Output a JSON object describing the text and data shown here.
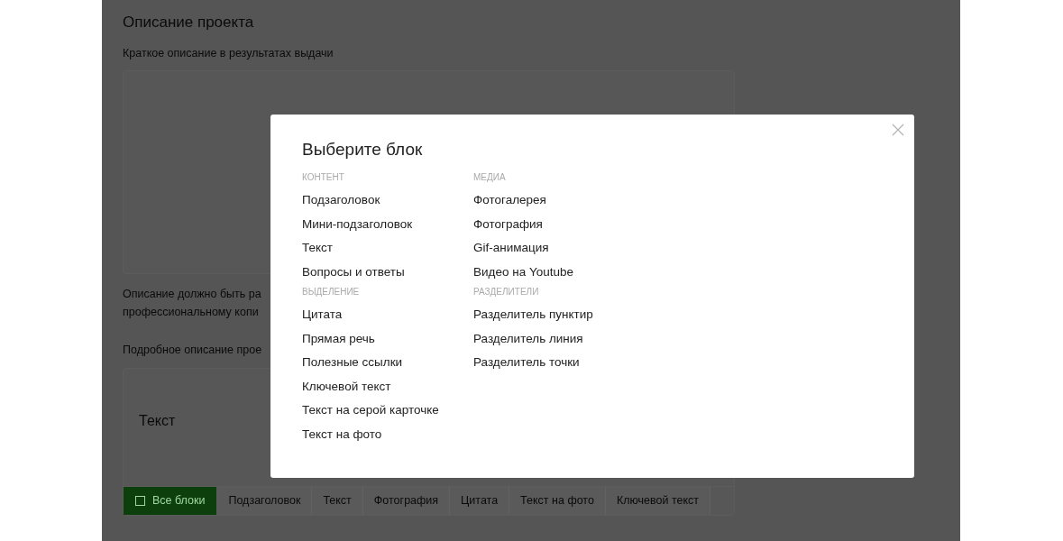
{
  "page": {
    "title": "Описание проекта",
    "short_label": "Краткое описание в результатах выдачи",
    "hint_lines": [
      "Описание должно быть ра",
      "профессиональному копи"
    ],
    "full_label": "Подробное описание прое",
    "editor_placeholder": "Текст",
    "toolbar": [
      {
        "label": "Все блоки",
        "selected": true
      },
      {
        "label": "Подзаголовок",
        "selected": false
      },
      {
        "label": "Текст",
        "selected": false
      },
      {
        "label": "Фотография",
        "selected": false
      },
      {
        "label": "Цитата",
        "selected": false
      },
      {
        "label": "Текст на фото",
        "selected": false
      },
      {
        "label": "Ключевой текст",
        "selected": false
      }
    ]
  },
  "modal": {
    "title": "Выберите блок",
    "columns": [
      {
        "groups": [
          {
            "heading": "КОНТЕНТ",
            "items": [
              "Подзаголовок",
              "Мини-подзаголовок",
              "Текст",
              "Вопросы и ответы"
            ]
          },
          {
            "heading": "ВЫДЕЛЕНИЕ",
            "items": [
              "Цитата",
              "Прямая речь",
              "Полезные ссылки",
              "Ключевой текст",
              "Текст на серой карточке",
              "Текст на фото"
            ]
          }
        ]
      },
      {
        "groups": [
          {
            "heading": "МЕДИА",
            "items": [
              "Фотогалерея",
              "Фотография",
              "Gif-анимация",
              "Видео на Youtube"
            ]
          },
          {
            "heading": "РАЗДЕЛИТЕЛИ",
            "items": [
              "Разделитель пунктир",
              "Разделитель линия",
              "Разделитель точки"
            ]
          }
        ]
      }
    ]
  }
}
